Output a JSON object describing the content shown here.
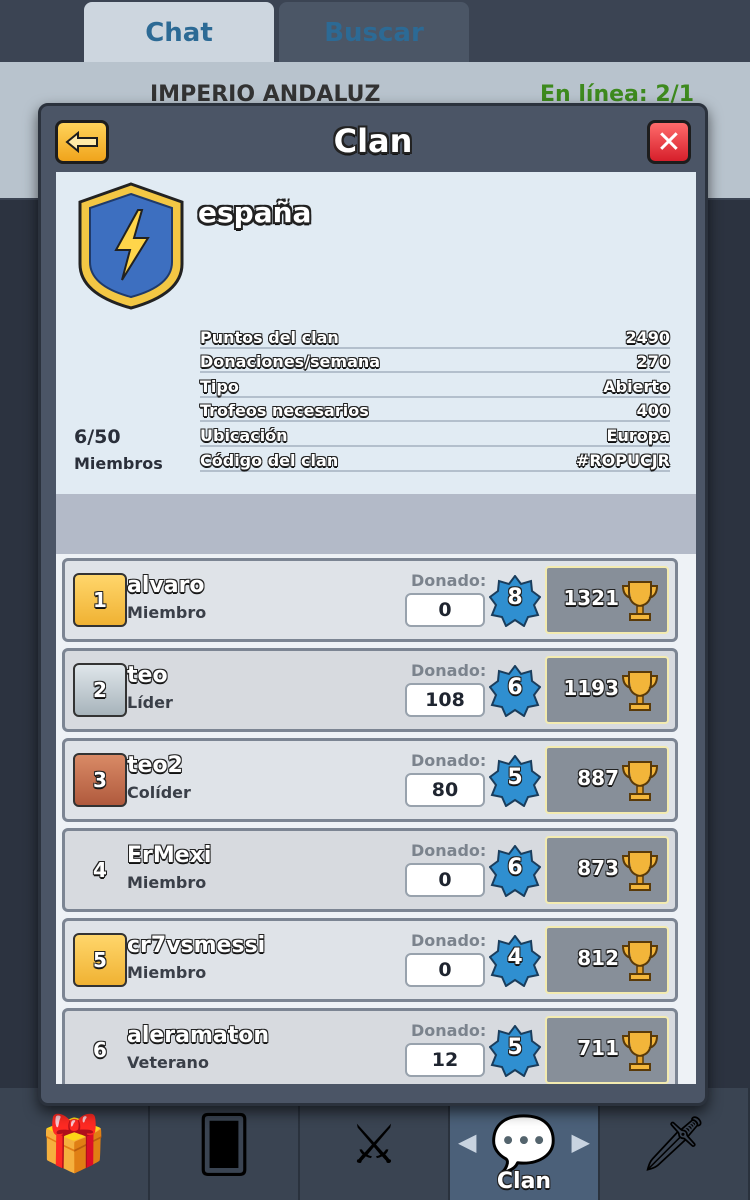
{
  "background": {
    "tabs": [
      "Chat",
      "Buscar"
    ],
    "clan_name": "IMPERIO ANDALUZ",
    "online": "En línea: 2/1"
  },
  "bottom_nav": {
    "clan_label": "Clan"
  },
  "modal": {
    "title": "Clan",
    "clan_name": "españa",
    "member_count": "6/50",
    "members_label": "Miembros",
    "stats": [
      {
        "label": "Puntos del clan",
        "value": "2490"
      },
      {
        "label": "Donaciones/semana",
        "value": "270"
      },
      {
        "label": "Tipo",
        "value": "Abierto"
      },
      {
        "label": "Trofeos necesarios",
        "value": "400"
      },
      {
        "label": "Ubicación",
        "value": "Europa"
      },
      {
        "label": "Código del clan",
        "value": "#ROPUCJR"
      }
    ]
  },
  "members": [
    {
      "rank": "1",
      "name": "alvaro",
      "role": "Miembro",
      "donated_label": "Donado:",
      "donated": "0",
      "level": "8",
      "trophies": "1321"
    },
    {
      "rank": "2",
      "name": "teo",
      "role": "Líder",
      "donated_label": "Donado:",
      "donated": "108",
      "level": "6",
      "trophies": "1193"
    },
    {
      "rank": "3",
      "name": "teo2",
      "role": "Colíder",
      "donated_label": "Donado:",
      "donated": "80",
      "level": "5",
      "trophies": "887"
    },
    {
      "rank": "4",
      "name": "ErMexi",
      "role": "Miembro",
      "donated_label": "Donado:",
      "donated": "0",
      "level": "6",
      "trophies": "873"
    },
    {
      "rank": "5",
      "name": "cr7vsmessi",
      "role": "Miembro",
      "donated_label": "Donado:",
      "donated": "0",
      "level": "4",
      "trophies": "812"
    },
    {
      "rank": "6",
      "name": "aleramaton",
      "role": "Veterano",
      "donated_label": "Donado:",
      "donated": "12",
      "level": "5",
      "trophies": "711"
    }
  ],
  "colors": {
    "accent_yellow": "#f0a41c",
    "close_red": "#d61f2b",
    "level_blue": "#2f8fd0"
  }
}
